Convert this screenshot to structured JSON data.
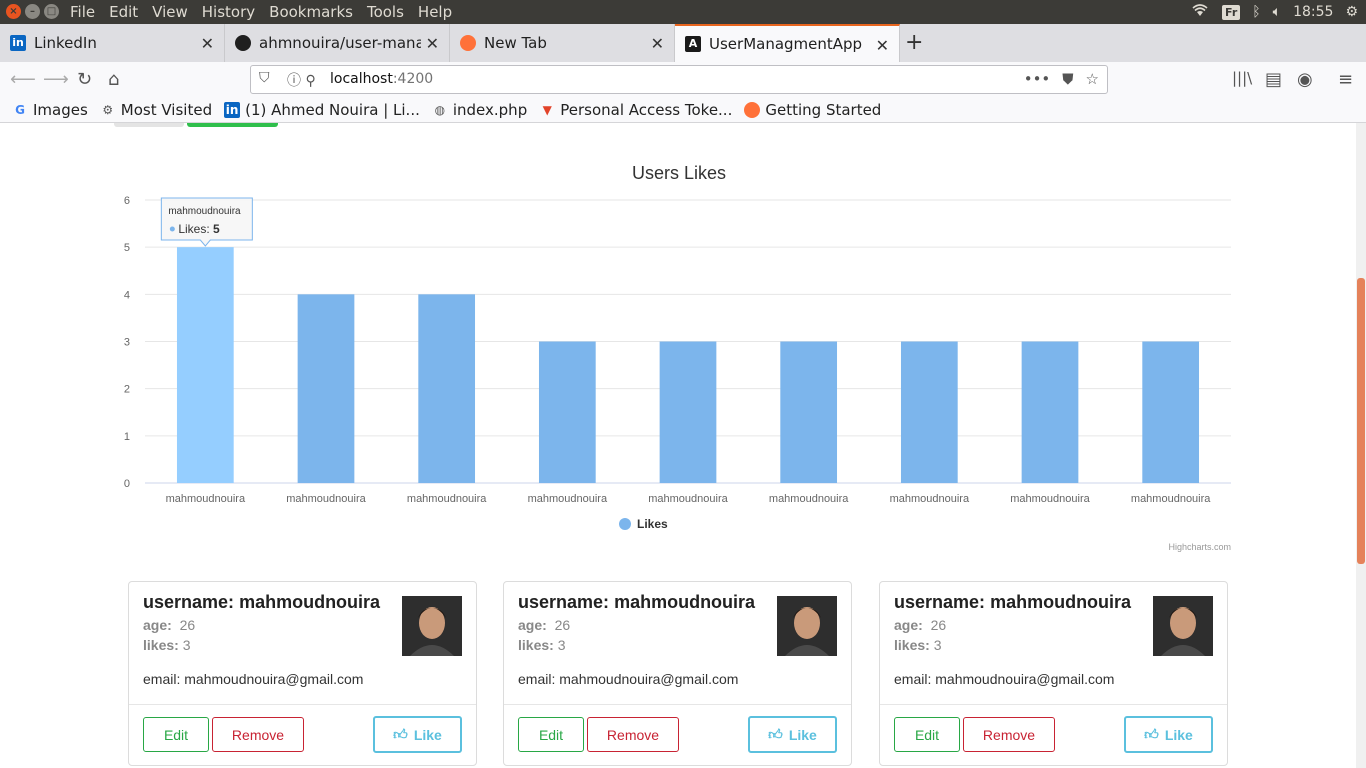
{
  "system_bar": {
    "menus": [
      "File",
      "Edit",
      "View",
      "History",
      "Bookmarks",
      "Tools",
      "Help"
    ],
    "keyboard_layout": "Fr",
    "time": "18:55"
  },
  "tabs": [
    {
      "label": "LinkedIn",
      "icon": "linkedin-icon",
      "active": false
    },
    {
      "label": "ahmnouira/user-manag",
      "icon": "github-icon",
      "active": false
    },
    {
      "label": "New Tab",
      "icon": "firefox-icon",
      "active": false
    },
    {
      "label": "UserManagmentApp",
      "icon": "angular-icon",
      "active": true
    }
  ],
  "url": {
    "host": "localhost",
    "port": ":4200"
  },
  "bookmarks": [
    {
      "label": "Images",
      "icon": "google-icon"
    },
    {
      "label": "Most Visited",
      "icon": "gear-icon"
    },
    {
      "label": "(1) Ahmed Nouira | Li...",
      "icon": "linkedin-icon"
    },
    {
      "label": "index.php",
      "icon": "globe-icon"
    },
    {
      "label": "Personal Access Toke...",
      "icon": "gitlab-icon"
    },
    {
      "label": "Getting Started",
      "icon": "firefox-icon"
    }
  ],
  "chart_data": {
    "type": "bar",
    "title": "Users Likes",
    "categories": [
      "mahmoudnouira",
      "mahmoudnouira",
      "mahmoudnouira",
      "mahmoudnouira",
      "mahmoudnouira",
      "mahmoudnouira",
      "mahmoudnouira",
      "mahmoudnouira",
      "mahmoudnouira"
    ],
    "series": [
      {
        "name": "Likes",
        "values": [
          5,
          4,
          4,
          3,
          3,
          3,
          3,
          3,
          3
        ],
        "color": "#7cb5ec",
        "hover_color": "#95ceff"
      }
    ],
    "ylim": [
      0,
      6
    ],
    "yticks": [
      0,
      1,
      2,
      3,
      4,
      5,
      6
    ],
    "grid": true,
    "legend": "bottom-center",
    "tooltip": {
      "category": "mahmoudnouira",
      "series": "Likes",
      "value": "5"
    },
    "credits": "Highcharts.com"
  },
  "cards": [
    {
      "username_label": "username:",
      "username": "mahmoudnouira",
      "age_label": "age:",
      "age": "26",
      "likes_label": "likes:",
      "likes": "3",
      "email_label": "email:",
      "email": "mahmoudnouira@gmail.com",
      "edit": "Edit",
      "remove": "Remove",
      "like": "Like"
    },
    {
      "username_label": "username:",
      "username": "mahmoudnouira",
      "age_label": "age:",
      "age": "26",
      "likes_label": "likes:",
      "likes": "3",
      "email_label": "email:",
      "email": "mahmoudnouira@gmail.com",
      "edit": "Edit",
      "remove": "Remove",
      "like": "Like"
    },
    {
      "username_label": "username:",
      "username": "mahmoudnouira",
      "age_label": "age:",
      "age": "26",
      "likes_label": "likes:",
      "likes": "3",
      "email_label": "email:",
      "email": "mahmoudnouira@gmail.com",
      "edit": "Edit",
      "remove": "Remove",
      "like": "Like"
    }
  ]
}
